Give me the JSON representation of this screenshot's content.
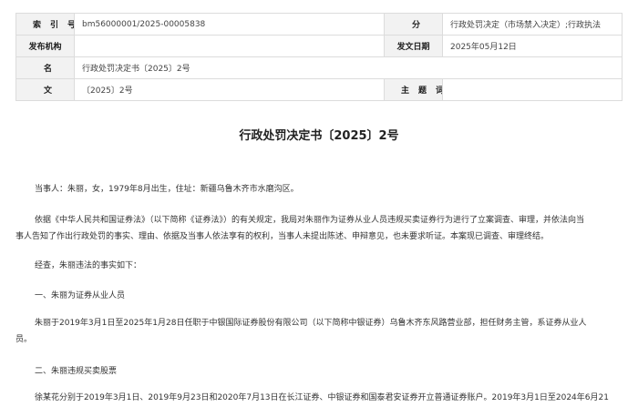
{
  "meta": {
    "index_label": "索引号",
    "index_value": "bm56000001/2025-00005838",
    "category_label": "分类",
    "category_value": "行政处罚决定（市场禁入决定）;行政执法",
    "issuer_label": "发布机构",
    "issuer_value": "",
    "date_label": "发文日期",
    "date_value": "2025年05月12日",
    "name_label": "名称",
    "name_value": "行政处罚决定书〔2025〕2号",
    "docno_label": "文号",
    "docno_value": "〔2025〕2号",
    "topic_label": "主题词",
    "topic_value": ""
  },
  "doc": {
    "title": "行政处罚决定书〔2025〕2号",
    "p1": "当事人：朱丽，女，1979年8月出生，住址：新疆乌鲁木齐市水磨沟区。",
    "p2a": "依据《中华人民共和国证券法》（以下简称《证券法》）的有关规定，我局对朱丽作为证券从业人员违规买卖证券行为进行了立案调查、审理，并依法向当",
    "p2b": "事人告知了作出行政处罚的事实、理由、依据及当事人依法享有的权利，当事人未提出陈述、申辩意见，也未要求听证。本案现已调查、审理终结。",
    "p3": "经查，朱丽违法的事实如下：",
    "h1": "一、朱丽为证券从业人员",
    "p4a": "朱丽于2019年3月1日至2025年1月28日任职于中银国际证券股份有限公司（以下简称中银证券）乌鲁木齐东风路营业部，担任财务主管，系证券从业人",
    "p4b": "员。",
    "h2": "二、朱丽违规买卖股票",
    "p5": "徐某花分别于2019年3月1日、2019年9月23日和2020年7月13日在长江证券、中银证券和国泰君安证券开立普通证券账户。2019年3月1日至2024年6月21"
  }
}
